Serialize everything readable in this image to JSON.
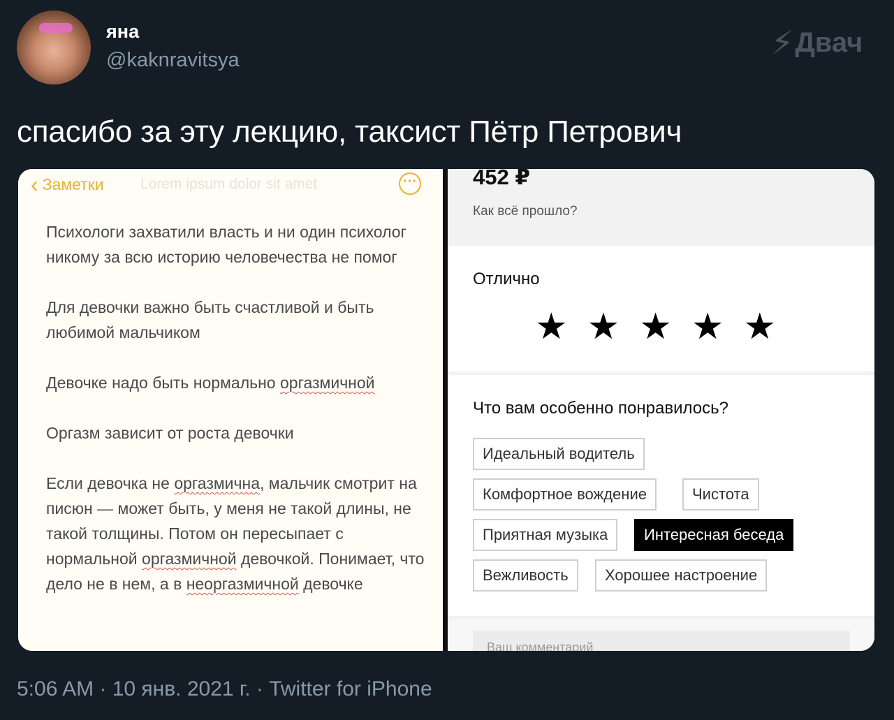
{
  "tweet": {
    "display_name": "яна",
    "handle": "@kaknravitsya",
    "text": "спасибо за эту лекцию, таксист Пётр Петрович",
    "meta": "5:06 AM · 10 янв. 2021 г. · Twitter for iPhone",
    "avatar_icon": "profile-photo",
    "watermark": "Двач",
    "watermark_icon": "lightning-bolt-icon"
  },
  "notes": {
    "back_label": "Заметки",
    "faded_title": "Lorem ipsum dolor sit amet",
    "more_icon": "ellipsis-circle-icon",
    "paragraphs": [
      "Психологи захватили власть и ни один психолог никому за всю историю человечества не помог",
      "Для девочки важно быть счастливой и быть любимой мальчиком",
      "Девочке надо быть нормально оргазмичной",
      "Оргазм зависит от роста девочки",
      "Если девочка не оргазмична, мальчик смотрит на писюн — может быть, у меня не такой длины, не такой толщины. Потом он пересыпает с нормальной оргазмичной девочкой. Понимает, что дело не в нем, а в неоргазмичной девочке"
    ]
  },
  "review": {
    "price": "452 ₽",
    "question": "Как всё прошло?",
    "rating_label": "Отлично",
    "rating": 5,
    "rating_max": 5,
    "liked_title": "Что вам особенно понравилось?",
    "chips": [
      {
        "label": "Идеальный водитель",
        "selected": false
      },
      {
        "label": "Комфортное вождение",
        "selected": false
      },
      {
        "label": "Чистота",
        "selected": false
      },
      {
        "label": "Приятная музыка",
        "selected": false
      },
      {
        "label": "Интересная беседа",
        "selected": true
      },
      {
        "label": "Вежливость",
        "selected": false
      },
      {
        "label": "Хорошее настроение",
        "selected": false
      }
    ],
    "comment_placeholder": "Ваш комментарий"
  }
}
